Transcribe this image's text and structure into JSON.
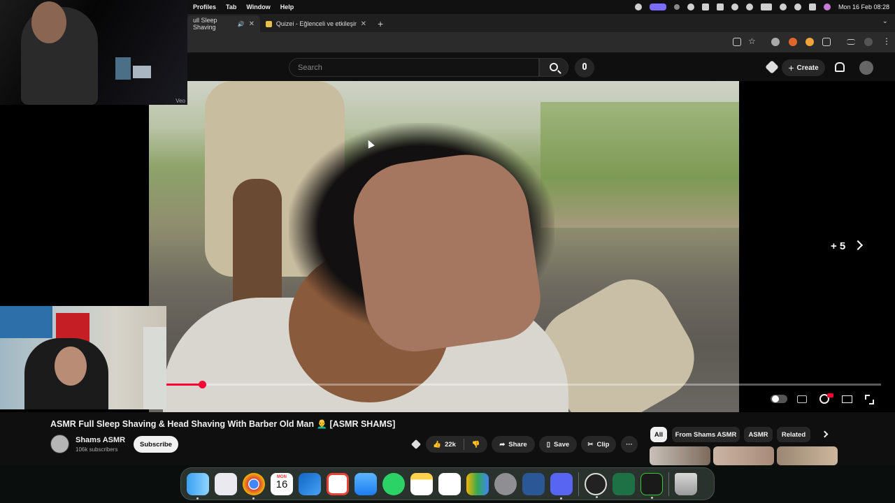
{
  "menubar": {
    "items": [
      "Profiles",
      "Tab",
      "Window",
      "Help"
    ],
    "datetime": "Mon 16 Feb  08:28"
  },
  "tabs": [
    {
      "title": "ull Sleep Shaving",
      "active": true
    },
    {
      "title": "Quizei - Eğlenceli ve etkileşim",
      "active": false
    }
  ],
  "youtube": {
    "search_placeholder": "Search",
    "create_label": "Create",
    "player": {
      "skip_label": "+ 5",
      "progress": 0.05
    },
    "video": {
      "title": "ASMR Full Sleep Shaving & Head Shaving With Barber Old Man 👨‍🦲 [ASMR SHAMS]",
      "channel_name": "Shams ASMR",
      "subscribers": "106k subscribers",
      "subscribe_label": "Subscribe",
      "likes": "22k",
      "share_label": "Share",
      "save_label": "Save",
      "clip_label": "Clip",
      "more_label": "···"
    },
    "chips": [
      "All",
      "From Shams ASMR",
      "ASMR",
      "Related"
    ]
  },
  "overlays": {
    "webcam_top_label": "Veo"
  },
  "dock": {
    "calendar_month": "MON",
    "calendar_day": "16"
  },
  "colors": {
    "accent_red": "#ff0033",
    "bg": "#0f0f0f"
  }
}
